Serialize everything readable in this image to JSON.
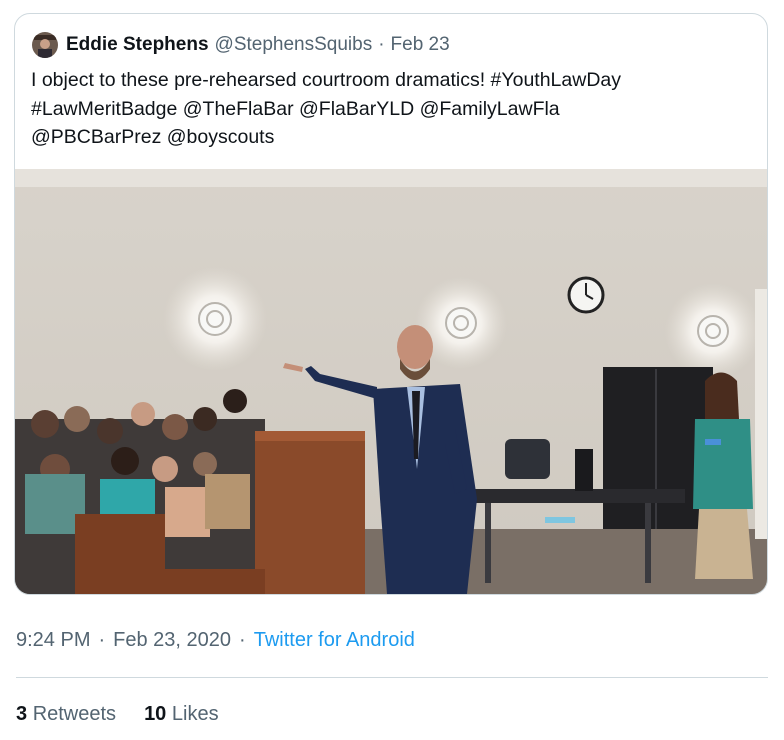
{
  "tweet": {
    "author_name": "Eddie Stephens",
    "handle": "@StephensSquibs",
    "separator": "·",
    "date_short": "Feb 23",
    "text_line1": "I object to these pre-rehearsed courtroom dramatics! #YouthLawDay",
    "text_line2": "#LawMeritBadge @TheFlaBar @FlaBarYLD @FamilyLawFla",
    "text_line3": "@PBCBarPrez @boyscouts"
  },
  "meta": {
    "time": "9:24 PM",
    "separator": "·",
    "date": "Feb 23, 2020",
    "source": "Twitter for Android"
  },
  "stats": {
    "retweets_count": "3",
    "retweets_label": "Retweets",
    "likes_count": "10",
    "likes_label": "Likes"
  },
  "colors": {
    "link": "#1d9bf0",
    "secondary_text": "#536471",
    "border": "#cfd9de"
  }
}
